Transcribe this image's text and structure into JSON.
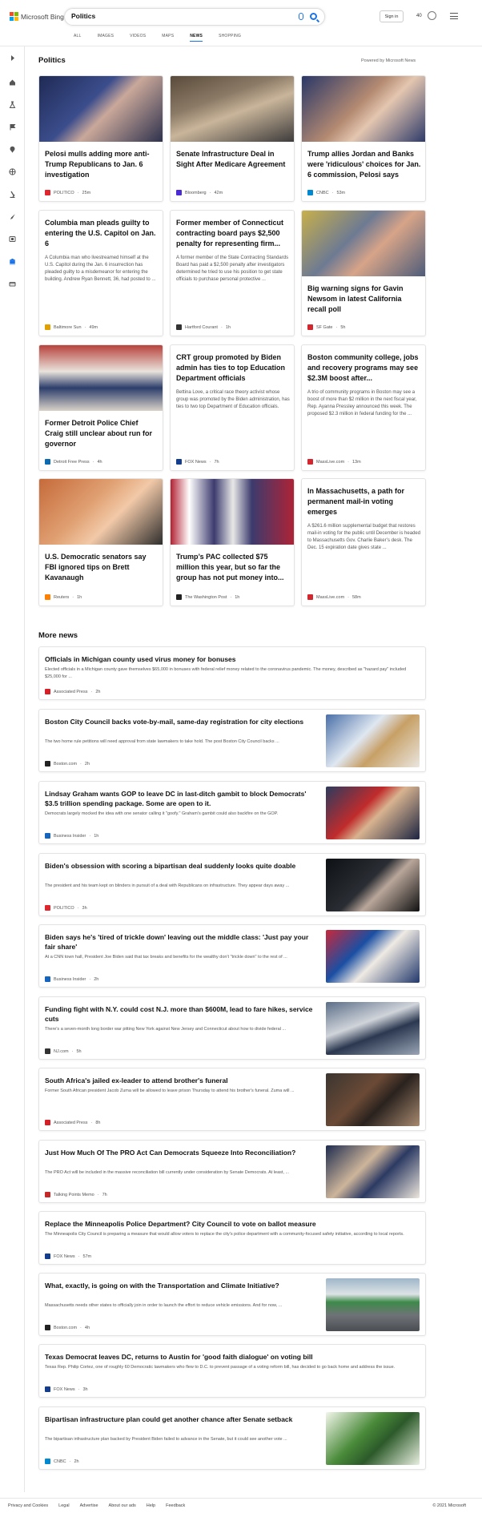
{
  "header": {
    "brand": "Microsoft Bing",
    "search_value": "Politics",
    "signin_label": "Sign in",
    "points": "40",
    "tabs": [
      "ALL",
      "IMAGES",
      "VIDEOS",
      "MAPS",
      "NEWS",
      "SHOPPING"
    ],
    "active_tab": "NEWS"
  },
  "colors": {
    "accent": "#1a73e8",
    "ms_red": "#f25022",
    "ms_green": "#7fba00",
    "ms_blue": "#00a4ef",
    "ms_yellow": "#ffb900"
  },
  "sidebar": {
    "icons": [
      "expand-icon",
      "home-icon",
      "flask-icon",
      "flag-icon",
      "location-icon",
      "globe-icon",
      "microscope-icon",
      "rocket-icon",
      "film-icon",
      "bank-icon",
      "money-icon"
    ]
  },
  "politics": {
    "title": "Politics",
    "powered_by": "Powered by Microsoft News",
    "cards": [
      {
        "title": "Pelosi mulls adding more anti-Trump Republicans to Jan. 6 investigation",
        "snippet": "",
        "source": "POLITICO",
        "time": "25m",
        "logo_color": "#e0262c",
        "image": true
      },
      {
        "title": "Senate Infrastructure Deal in Sight After Medicare Agreement",
        "snippet": "",
        "source": "Bloomberg",
        "time": "42m",
        "logo_color": "#4b2bd6",
        "image": true
      },
      {
        "title": "Trump allies Jordan and Banks were 'ridiculous' choices for Jan. 6 commission, Pelosi says",
        "snippet": "",
        "source": "CNBC",
        "time": "53m",
        "logo_color": "#0089d0",
        "image": true
      },
      {
        "title": "Columbia man pleads guilty to entering the U.S. Capitol on Jan. 6",
        "snippet": "A Columbia man who livestreamed himself at the U.S. Capitol during the Jan. 6 insurrection has pleaded guilty to a misdemeanor for entering the building. Andrew Ryan Bennett, 36, had posted to ...",
        "source": "Baltimore Sun",
        "time": "49m",
        "logo_color": "#e0a100",
        "image": false
      },
      {
        "title": "Former member of Connecticut contracting board pays $2,500 penalty for representing firm...",
        "snippet": "A former member of the State Contracting Standards Board has paid a $2,500 penalty after investigators determined he tried to use his position to get state officials to purchase personal protective ...",
        "source": "Hartford Courant",
        "time": "1h",
        "logo_color": "#333333",
        "image": false
      },
      {
        "title": "Big warning signs for Gavin Newsom in latest California recall poll",
        "snippet": "",
        "source": "SF Gate",
        "time": "5h",
        "logo_color": "#d4262f",
        "image": true
      },
      {
        "title": "Former Detroit Police Chief Craig still unclear about run for governor",
        "snippet": "",
        "source": "Detroit Free Press",
        "time": "4h",
        "logo_color": "#0b6ab0",
        "image": true
      },
      {
        "title": "CRT group promoted by Biden admin has ties to top Education Department officials",
        "snippet": "Bettina Love, a critical race theory activist whose group was promoted by the Biden administration, has ties to two top Department of Education officials.",
        "source": "FOX News",
        "time": "7h",
        "logo_color": "#143d8d",
        "image": false
      },
      {
        "title": "Boston community college, jobs and recovery programs may see $2.3M boost after...",
        "snippet": "A trio of community programs in Boston may see a boost of more than $2 million in the next fiscal year, Rep. Ayanna Pressley announced this week. The proposed $2.3 million in federal funding for the ...",
        "source": "MassLive.com",
        "time": "13m",
        "logo_color": "#d4262f",
        "image": false
      },
      {
        "title": "U.S. Democratic senators say FBI ignored tips on Brett Kavanaugh",
        "snippet": "",
        "source": "Reuters",
        "time": "1h",
        "logo_color": "#ff8000",
        "image": true
      },
      {
        "title": "Trump’s PAC collected $75 million this year, but so far the group has not put money into...",
        "snippet": "",
        "source": "The Washington Post",
        "time": "1h",
        "logo_color": "#222222",
        "image": true
      },
      {
        "title": "In Massachusetts, a path for permanent mail-in voting emerges",
        "snippet": "A $261.6 million supplemental budget that restores mail-in voting for the public until December is headed to Massachusetts Gov. Charlie Baker’s desk. The Dec. 15 expiration date gives state ...",
        "source": "MassLive.com",
        "time": "58m",
        "logo_color": "#d4262f",
        "image": false
      }
    ]
  },
  "more_news": {
    "title": "More news",
    "items": [
      {
        "title": "Officials in Michigan county used virus money for bonuses",
        "snippet": "Elected officials in a Michigan county gave themselves $65,000 in bonuses with federal relief money related to the coronavirus pandemic. The money, described as \"hazard pay\" included $25,000 for ...",
        "source": "Associated Press",
        "time": "2h",
        "logo_color": "#d71f26",
        "image": false
      },
      {
        "title": "Boston City Council backs vote-by-mail, same-day registration for city elections",
        "snippet": "The two home rule petitions will need approval from state lawmakers to take hold. The post Boston City Council backs ...",
        "source": "Boston.com",
        "time": "2h",
        "logo_color": "#222222",
        "image": true
      },
      {
        "title": "Lindsay Graham wants GOP to leave DC in last-ditch gambit to block Democrats' $3.5 trillion spending package. Some are open to it.",
        "snippet": "Democrats largely mocked the idea with one senator calling it \"goofy.\" Graham's gambit could also backfire on the GOP.",
        "source": "Business Insider",
        "time": "1h",
        "logo_color": "#1565c0",
        "image": true
      },
      {
        "title": "Biden's obsession with scoring a bipartisan deal suddenly looks quite doable",
        "snippet": "The president and his team kept on blinders in pursuit of a deal with Republicans on infrastructure. They appear days away ...",
        "source": "POLITICO",
        "time": "3h",
        "logo_color": "#e0262c",
        "image": true
      },
      {
        "title": "Biden says he's 'tired of trickle down' leaving out the middle class: 'Just pay your fair share'",
        "snippet": "At a CNN town hall, President Joe Biden said that tax breaks and benefits for the wealthy don't \"trickle down\" to the rest of ...",
        "source": "Business Insider",
        "time": "2h",
        "logo_color": "#1565c0",
        "image": true
      },
      {
        "title": "Funding fight with N.Y. could cost N.J. more than $600M, lead to fare hikes, service cuts",
        "snippet": "There's a seven-month long border war pitting New York against New Jersey and Connecticut about how to divide federal ...",
        "source": "NJ.com",
        "time": "5h",
        "logo_color": "#333333",
        "image": true
      },
      {
        "title": "South Africa's jailed ex-leader to attend brother's funeral",
        "snippet": "Former South African president Jacob Zuma will be allowed to leave prison Thursday to attend his brother's funeral. Zuma will ...",
        "source": "Associated Press",
        "time": "8h",
        "logo_color": "#d71f26",
        "image": true
      },
      {
        "title": "Just How Much Of The PRO Act Can Democrats Squeeze Into Reconciliation?",
        "snippet": "The PRO Act will be included in the massive reconciliation bill currently under consideration by Senate Democrats. At least, ...",
        "source": "Talking Points Memo",
        "time": "7h",
        "logo_color": "#c62828",
        "image": true
      },
      {
        "title": "Replace the Minneapolis Police Department? City Council to vote on ballot measure",
        "snippet": "The Minneapolis City Council is preparing a measure that would allow voters to replace the city's police department with a community-focused safety initiative, according to local reports.",
        "source": "FOX News",
        "time": "57m",
        "logo_color": "#143d8d",
        "image": false
      },
      {
        "title": "What, exactly, is going on with the Transportation and Climate Initiative?",
        "snippet": "Massachusetts needs other states to officially join in order to launch the effort to reduce vehicle emissions. And for now, ...",
        "source": "Boston.com",
        "time": "4h",
        "logo_color": "#222222",
        "image": true
      },
      {
        "title": "Texas Democrat leaves DC, returns to Austin for 'good faith dialogue' on voting bill",
        "snippet": "Texas Rep. Philip Cortez, one of roughly 60 Democratic lawmakers who flew to D.C. to prevent passage of a voting reform bill, has decided to go back home and address the issue.",
        "source": "FOX News",
        "time": "3h",
        "logo_color": "#143d8d",
        "image": false
      },
      {
        "title": "Bipartisan infrastructure plan could get another chance after Senate setback",
        "snippet": "The bipartisan infrastructure plan backed by President Biden failed to advance in the Senate, but it could see another vote ...",
        "source": "CNBC",
        "time": "2h",
        "logo_color": "#0089d0",
        "image": true
      }
    ]
  },
  "footer": {
    "links": [
      "Privacy and Cookies",
      "Legal",
      "Advertise",
      "About our ads",
      "Help",
      "Feedback"
    ],
    "copyright": "© 2021 Microsoft"
  }
}
